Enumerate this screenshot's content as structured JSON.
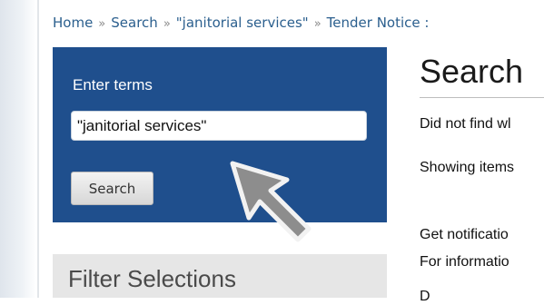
{
  "breadcrumb": {
    "items": [
      "Home",
      "Search",
      "\"janitorial services\"",
      "Tender Notice :"
    ],
    "separator": "»"
  },
  "search_panel": {
    "label": "Enter terms",
    "input_value": "\"janitorial services\"",
    "button_label": "Search"
  },
  "filter": {
    "title": "Filter Selections"
  },
  "main": {
    "title": "Search",
    "lines": [
      "Did not find wl",
      "Showing items",
      "Get notificatio",
      "For informatio",
      "D"
    ]
  },
  "icons": {
    "cursor": "pointer-arrow-icon"
  },
  "colors": {
    "panel_bg": "#1f4f8d",
    "link": "#2b5f8e",
    "filter_bg": "#e6e6e6"
  }
}
